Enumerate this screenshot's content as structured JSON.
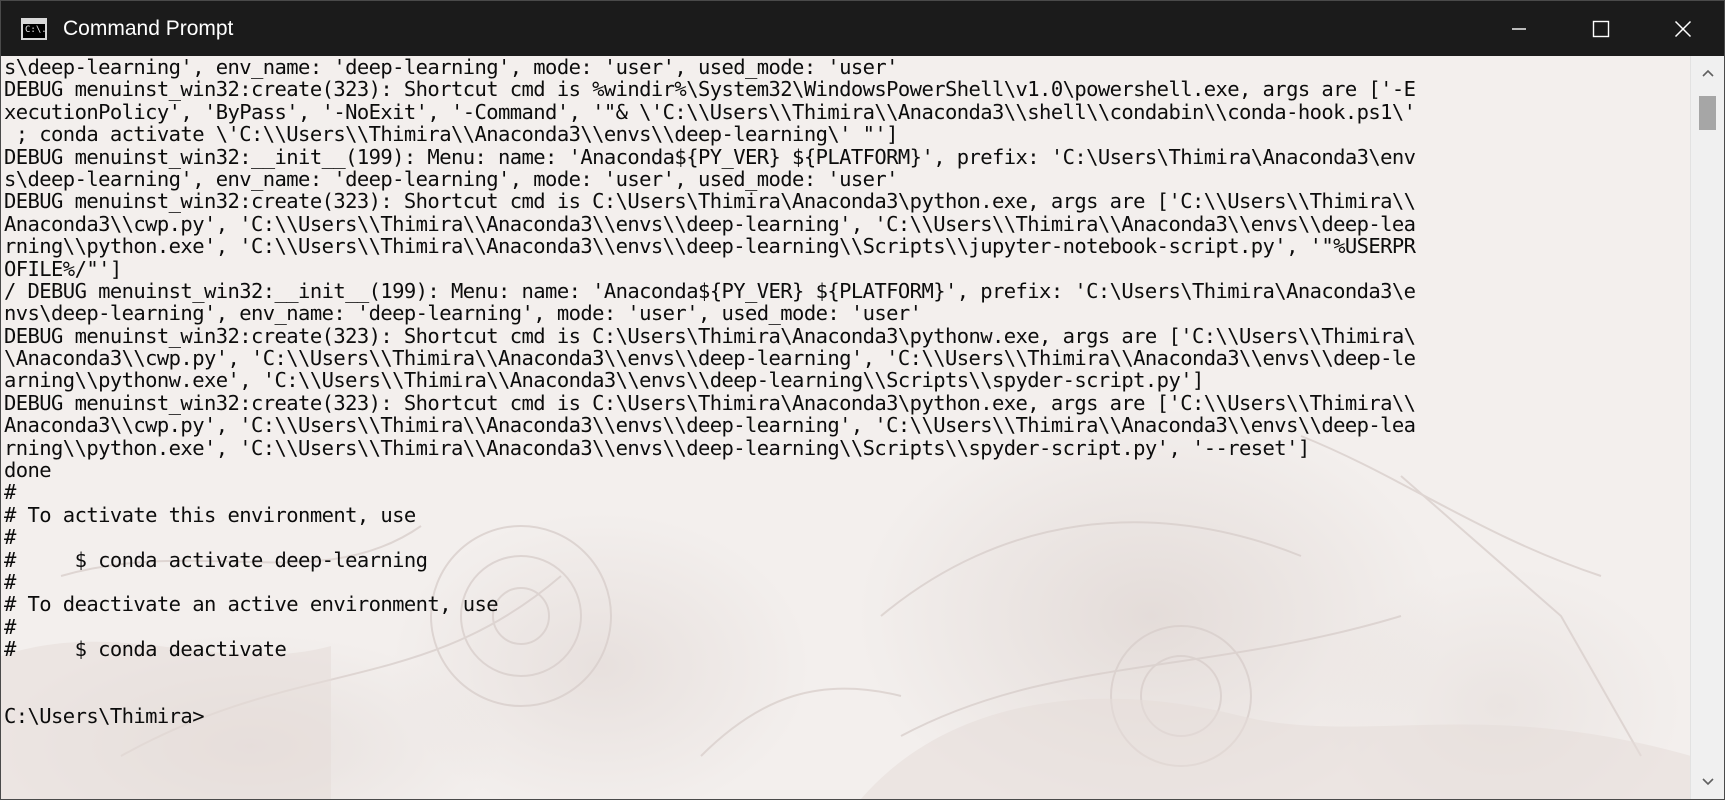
{
  "window": {
    "title": "Command Prompt",
    "app_icon": "cmd-icon",
    "app_icon_text": "C:\\.",
    "controls": {
      "minimize_icon": "minimize-icon",
      "maximize_icon": "maximize-icon",
      "close_icon": "close-icon"
    }
  },
  "console": {
    "lines": [
      "s\\deep-learning', env_name: 'deep-learning', mode: 'user', used_mode: 'user'",
      "DEBUG menuinst_win32:create(323): Shortcut cmd is %windir%\\System32\\WindowsPowerShell\\v1.0\\powershell.exe, args are ['-E",
      "xecutionPolicy', 'ByPass', '-NoExit', '-Command', '\"& \\'C:\\\\Users\\\\Thimira\\\\Anaconda3\\\\shell\\\\condabin\\\\conda-hook.ps1\\'",
      " ; conda activate \\'C:\\\\Users\\\\Thimira\\\\Anaconda3\\\\envs\\\\deep-learning\\' \"']",
      "DEBUG menuinst_win32:__init__(199): Menu: name: 'Anaconda${PY_VER} ${PLATFORM}', prefix: 'C:\\Users\\Thimira\\Anaconda3\\env",
      "s\\deep-learning', env_name: 'deep-learning', mode: 'user', used_mode: 'user'",
      "DEBUG menuinst_win32:create(323): Shortcut cmd is C:\\Users\\Thimira\\Anaconda3\\python.exe, args are ['C:\\\\Users\\\\Thimira\\\\",
      "Anaconda3\\\\cwp.py', 'C:\\\\Users\\\\Thimira\\\\Anaconda3\\\\envs\\\\deep-learning', 'C:\\\\Users\\\\Thimira\\\\Anaconda3\\\\envs\\\\deep-lea",
      "rning\\\\python.exe', 'C:\\\\Users\\\\Thimira\\\\Anaconda3\\\\envs\\\\deep-learning\\\\Scripts\\\\jupyter-notebook-script.py', '\"%USERPR",
      "OFILE%/\"']",
      "/ DEBUG menuinst_win32:__init__(199): Menu: name: 'Anaconda${PY_VER} ${PLATFORM}', prefix: 'C:\\Users\\Thimira\\Anaconda3\\e",
      "nvs\\deep-learning', env_name: 'deep-learning', mode: 'user', used_mode: 'user'",
      "DEBUG menuinst_win32:create(323): Shortcut cmd is C:\\Users\\Thimira\\Anaconda3\\pythonw.exe, args are ['C:\\\\Users\\\\Thimira\\",
      "\\Anaconda3\\\\cwp.py', 'C:\\\\Users\\\\Thimira\\\\Anaconda3\\\\envs\\\\deep-learning', 'C:\\\\Users\\\\Thimira\\\\Anaconda3\\\\envs\\\\deep-le",
      "arning\\\\pythonw.exe', 'C:\\\\Users\\\\Thimira\\\\Anaconda3\\\\envs\\\\deep-learning\\\\Scripts\\\\spyder-script.py']",
      "DEBUG menuinst_win32:create(323): Shortcut cmd is C:\\Users\\Thimira\\Anaconda3\\python.exe, args are ['C:\\\\Users\\\\Thimira\\\\",
      "Anaconda3\\\\cwp.py', 'C:\\\\Users\\\\Thimira\\\\Anaconda3\\\\envs\\\\deep-learning', 'C:\\\\Users\\\\Thimira\\\\Anaconda3\\\\envs\\\\deep-lea",
      "rning\\\\python.exe', 'C:\\\\Users\\\\Thimira\\\\Anaconda3\\\\envs\\\\deep-learning\\\\Scripts\\\\spyder-script.py', '--reset']",
      "done",
      "#",
      "# To activate this environment, use",
      "#",
      "#     $ conda activate deep-learning",
      "#",
      "# To deactivate an active environment, use",
      "#",
      "#     $ conda deactivate",
      "",
      "",
      "C:\\Users\\Thimira>"
    ]
  },
  "scrollbar": {
    "up_icon": "scroll-up-arrow-icon",
    "down_icon": "scroll-down-arrow-icon",
    "position": 0.05
  },
  "colors": {
    "titlebar": "#1b1b1b",
    "console_bg": "#f3efed",
    "console_text": "#0c0c0c"
  }
}
